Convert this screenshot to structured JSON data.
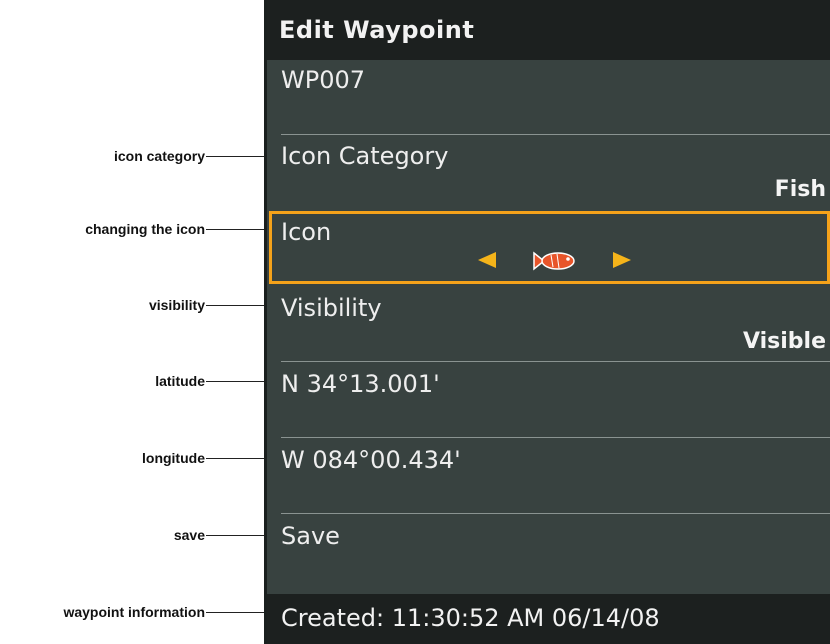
{
  "callouts": {
    "icon_category": "icon category",
    "changing_icon": "changing the icon",
    "visibility": "visibility",
    "latitude": "latitude",
    "longitude": "longitude",
    "save": "save",
    "waypoint_info": "waypoint information"
  },
  "screen": {
    "title": "Edit Waypoint",
    "name": "WP007",
    "icon_category_label": "Icon Category",
    "icon_category_value": "Fish",
    "icon_label": "Icon",
    "icon_value": "fish-icon",
    "visibility_label": "Visibility",
    "visibility_value": "Visible",
    "latitude": "N 34°13.001'",
    "longitude": "W 084°00.434'",
    "save_label": "Save",
    "created": "Created: 11:30:52 AM 06/14/08"
  },
  "colors": {
    "screen_bg": "#384240",
    "bar_bg": "#1c201f",
    "accent": "#f5a21a",
    "text": "#eeeeee"
  }
}
